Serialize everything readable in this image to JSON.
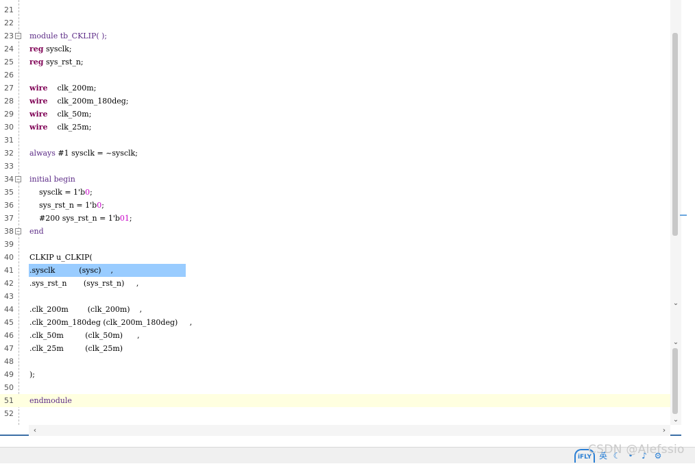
{
  "editor": {
    "lines": [
      {
        "n": "21",
        "parts": []
      },
      {
        "n": "22",
        "parts": []
      },
      {
        "n": "23",
        "fold": true,
        "parts": [
          {
            "t": "module tb_CKLIP( );",
            "c": "kw2"
          }
        ]
      },
      {
        "n": "24",
        "parts": [
          {
            "t": "reg",
            "c": "kw"
          },
          {
            "t": " sysclk;"
          }
        ]
      },
      {
        "n": "25",
        "parts": [
          {
            "t": "reg",
            "c": "kw"
          },
          {
            "t": " sys_rst_n;"
          }
        ]
      },
      {
        "n": "26",
        "parts": []
      },
      {
        "n": "27",
        "parts": [
          {
            "t": "wire",
            "c": "kw"
          },
          {
            "t": "    clk_200m;"
          }
        ]
      },
      {
        "n": "28",
        "parts": [
          {
            "t": "wire",
            "c": "kw"
          },
          {
            "t": "    clk_200m_180deg;"
          }
        ]
      },
      {
        "n": "29",
        "parts": [
          {
            "t": "wire",
            "c": "kw"
          },
          {
            "t": "    clk_50m;"
          }
        ]
      },
      {
        "n": "30",
        "parts": [
          {
            "t": "wire",
            "c": "kw"
          },
          {
            "t": "    clk_25m;"
          }
        ]
      },
      {
        "n": "31",
        "parts": []
      },
      {
        "n": "32",
        "parts": [
          {
            "t": "always",
            "c": "kw2"
          },
          {
            "t": " #1 sysclk = ~sysclk;"
          }
        ]
      },
      {
        "n": "33",
        "parts": []
      },
      {
        "n": "34",
        "fold": true,
        "parts": [
          {
            "t": "initial begin",
            "c": "kw2"
          }
        ]
      },
      {
        "n": "35",
        "parts": [
          {
            "t": "    sysclk = 1'b"
          },
          {
            "t": "0",
            "c": "num"
          },
          {
            "t": ";"
          }
        ]
      },
      {
        "n": "36",
        "parts": [
          {
            "t": "    sys_rst_n = 1'b"
          },
          {
            "t": "0",
            "c": "num"
          },
          {
            "t": ";"
          }
        ]
      },
      {
        "n": "37",
        "parts": [
          {
            "t": "    #200 sys_rst_n = 1'b"
          },
          {
            "t": "01",
            "c": "num"
          },
          {
            "t": ";"
          }
        ]
      },
      {
        "n": "38",
        "fold": true,
        "parts": [
          {
            "t": "end",
            "c": "kw2"
          }
        ]
      },
      {
        "n": "39",
        "parts": []
      },
      {
        "n": "40",
        "parts": [
          {
            "t": "CLKIP u_CLKIP("
          }
        ]
      },
      {
        "n": "41",
        "selected": true,
        "parts": [
          {
            "t": ".sysclk          (sysc)    ,"
          }
        ]
      },
      {
        "n": "42",
        "parts": [
          {
            "t": ".sys_rst_n       (sys_rst_n)     ,"
          }
        ]
      },
      {
        "n": "43",
        "parts": []
      },
      {
        "n": "44",
        "parts": [
          {
            "t": ".clk_200m        (clk_200m)    ,"
          }
        ]
      },
      {
        "n": "45",
        "parts": [
          {
            "t": ".clk_200m_180deg (clk_200m_180deg)     ,"
          }
        ]
      },
      {
        "n": "46",
        "parts": [
          {
            "t": ".clk_50m         (clk_50m)      ,"
          }
        ]
      },
      {
        "n": "47",
        "parts": [
          {
            "t": ".clk_25m         (clk_25m)"
          }
        ]
      },
      {
        "n": "48",
        "parts": []
      },
      {
        "n": "49",
        "parts": [
          {
            "t": ");"
          }
        ]
      },
      {
        "n": "50",
        "parts": []
      },
      {
        "n": "51",
        "current": true,
        "parts": [
          {
            "t": "endmodule",
            "c": "kw2"
          }
        ]
      },
      {
        "n": "52",
        "parts": []
      }
    ]
  },
  "icons": {
    "fold": "fold-collapse-icon",
    "scroll_up": "chevron-down-icon",
    "scroll_left": "chevron-left-icon",
    "scroll_right": "chevron-right-icon"
  },
  "watermark": "CSDN @Alefssio",
  "ime": {
    "logo": "iFLY",
    "lang": "英"
  },
  "colors": {
    "keyword": "#7f0055",
    "keyword2": "#5b2a86",
    "number": "#c800c8",
    "selection": "#99ccff",
    "current_line": "#ffffe0",
    "border": "#3a6ea5"
  }
}
